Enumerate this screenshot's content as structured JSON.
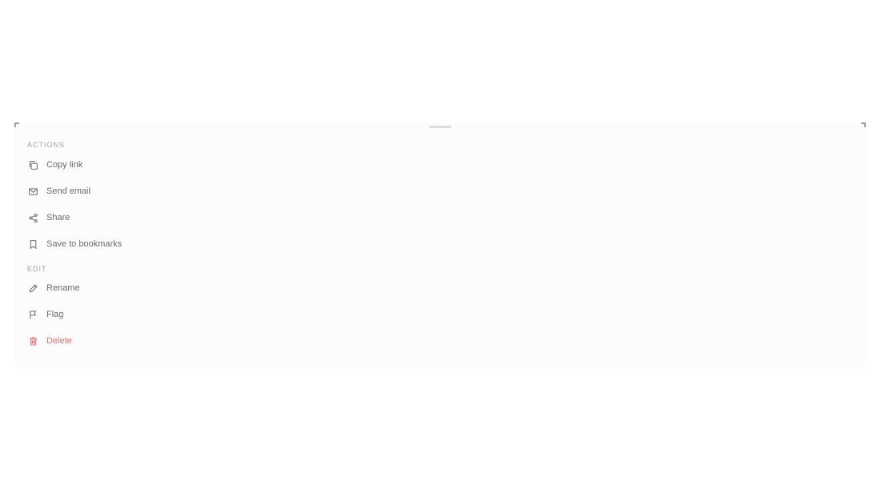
{
  "sheet": {
    "sections": [
      {
        "label": "ACTIONS",
        "items": [
          {
            "label": "Copy link",
            "icon": "copy-icon"
          },
          {
            "label": "Send email",
            "icon": "mail-icon"
          },
          {
            "label": "Share",
            "icon": "share-icon"
          },
          {
            "label": "Save to bookmarks",
            "icon": "bookmark-icon"
          }
        ]
      },
      {
        "label": "EDIT",
        "items": [
          {
            "label": "Rename",
            "icon": "pencil-icon"
          },
          {
            "label": "Flag",
            "icon": "flag-icon"
          },
          {
            "label": "Delete",
            "icon": "trash-icon",
            "danger": true
          }
        ]
      }
    ],
    "colors": {
      "danger": "#f06a6a",
      "text": "#6a6a6a",
      "section_label": "#a5a5a5",
      "background": "#fcfcfc"
    }
  }
}
